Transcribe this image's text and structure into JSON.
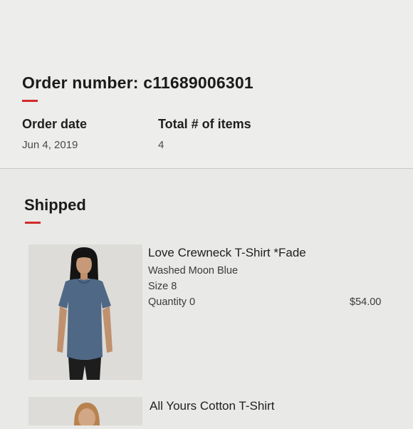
{
  "order": {
    "number_label": "Order number: c11689006301",
    "date_label": "Order date",
    "date_value": "Jun 4, 2019",
    "items_label": "Total # of items",
    "items_value": "4"
  },
  "section": {
    "title": "Shipped"
  },
  "products": [
    {
      "name": "Love Crewneck T-Shirt *Fade",
      "color": "Washed Moon Blue",
      "size": "Size 8",
      "quantity": "Quantity 0",
      "price": "$54.00",
      "image": "model-wearing-blue-tshirt"
    },
    {
      "name": "All Yours Cotton T-Shirt",
      "image": "model-photo"
    }
  ],
  "colors": {
    "accent": "#d22b2b",
    "shirt": "#4f6886"
  }
}
